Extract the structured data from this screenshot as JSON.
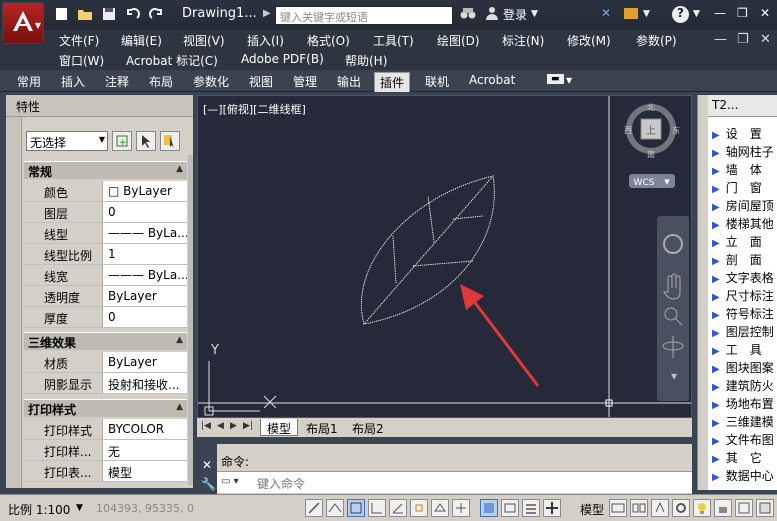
{
  "title_bar": {
    "document_title": "Drawing1...",
    "search_placeholder": "键入关键字或短语",
    "login_label": "登录",
    "help_label": "?"
  },
  "menus": {
    "row1": [
      "文件(F)",
      "编辑(E)",
      "视图(V)",
      "插入(I)",
      "格式(O)",
      "工具(T)",
      "绘图(D)",
      "标注(N)",
      "修改(M)",
      "参数(P)"
    ],
    "row2": [
      "窗口(W)",
      "Acrobat 标记(C)",
      "Adobe PDF(B)",
      "帮助(H)"
    ]
  },
  "ribbon_tabs": [
    "常用",
    "插入",
    "注释",
    "布局",
    "参数化",
    "视图",
    "管理",
    "输出",
    "插件",
    "联机",
    "Acrobat"
  ],
  "ribbon_active": "插件",
  "properties": {
    "title": "特性",
    "selection": "无选择",
    "sections": {
      "general": "常规",
      "three_d": "三维效果",
      "plot": "打印样式"
    },
    "general_rows": [
      {
        "k": "颜色",
        "v": "□ ByLayer"
      },
      {
        "k": "图层",
        "v": "0"
      },
      {
        "k": "线型",
        "v": "——— ByLa..."
      },
      {
        "k": "线型比例",
        "v": "1"
      },
      {
        "k": "线宽",
        "v": "——— ByLa..."
      },
      {
        "k": "透明度",
        "v": "ByLayer"
      },
      {
        "k": "厚度",
        "v": "0"
      }
    ],
    "three_d_rows": [
      {
        "k": "材质",
        "v": "ByLayer"
      },
      {
        "k": "阴影显示",
        "v": "投射和接收..."
      }
    ],
    "plot_rows": [
      {
        "k": "打印样式",
        "v": "BYCOLOR"
      },
      {
        "k": "打印样...",
        "v": "无"
      },
      {
        "k": "打印表...",
        "v": "模型"
      }
    ]
  },
  "viewport": {
    "label": "[—][俯视][二维线框]",
    "viewcube": {
      "n": "北",
      "s": "南",
      "w": "西",
      "e": "东",
      "face": "上",
      "wcs": "WCS"
    },
    "ucs_y": "Y"
  },
  "layout_tabs": [
    "模型",
    "布局1",
    "布局2"
  ],
  "layout_active": "模型",
  "command": {
    "label": "命令:",
    "placeholder": "键入命令"
  },
  "t20": {
    "title": "T2...",
    "items": [
      "设　置",
      "轴网柱子",
      "墙　体",
      "门　窗",
      "房间屋顶",
      "楼梯其他",
      "立　面",
      "剖　面",
      "文字表格",
      "尺寸标注",
      "符号标注",
      "图层控制",
      "工　具",
      "图块图案",
      "建筑防火",
      "场地布置",
      "三维建模",
      "文件布图",
      "其　它",
      "数据中心"
    ]
  },
  "status_bar": {
    "scale": "比例 1:100",
    "coords": "104393, 95335, 0",
    "model": "模型"
  },
  "colors": {
    "canvas_bg": "#25293a",
    "leaf_stroke": "#ffffff",
    "arrow": "#e2383a"
  }
}
